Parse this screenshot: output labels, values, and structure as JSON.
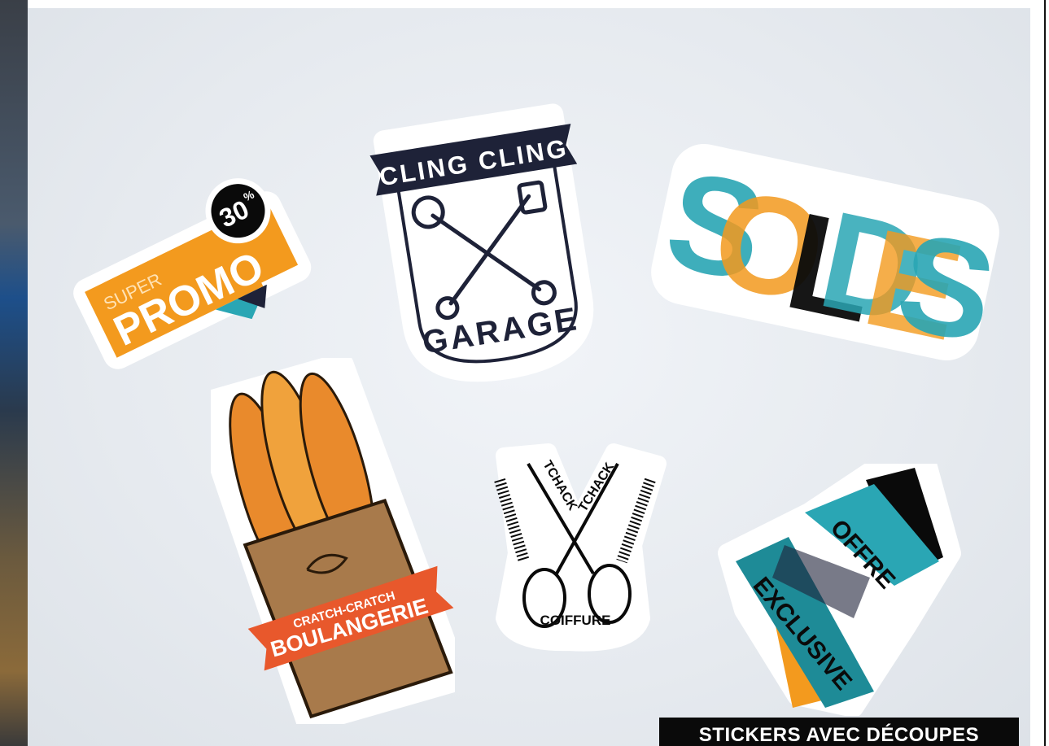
{
  "stickers": {
    "promo": {
      "super": "SUPER",
      "promo": "PROMO",
      "percent_value": "30",
      "percent_sign": "%"
    },
    "garage": {
      "top_banner": "CLING CLING",
      "bottom_text": "GARAGE"
    },
    "soldes": {
      "letters": [
        "S",
        "O",
        "L",
        "D",
        "E",
        "S"
      ]
    },
    "boulangerie": {
      "small_text": "CRATCH-CRATCH",
      "big_text": "BOULANGERIE"
    },
    "coiffure": {
      "left_text": "TCHACK",
      "right_text": "TCHACK",
      "bottom_text": "COIFFURE"
    },
    "exclusive": {
      "offre": "OFFRE",
      "exclusive": "EXCLUSIVE"
    }
  },
  "caption": "STICKERS AVEC DÉCOUPES",
  "colors": {
    "orange": "#f39a1e",
    "teal": "#2aa6b4",
    "navy": "#1e2238",
    "black": "#0a0a0a",
    "bread": "#e98a2c",
    "bag": "#a87a4b",
    "ribbon": "#e8582c"
  },
  "icons": [
    "wrench-crossed-icon",
    "baguette-icon",
    "scissors-comb-icon"
  ]
}
